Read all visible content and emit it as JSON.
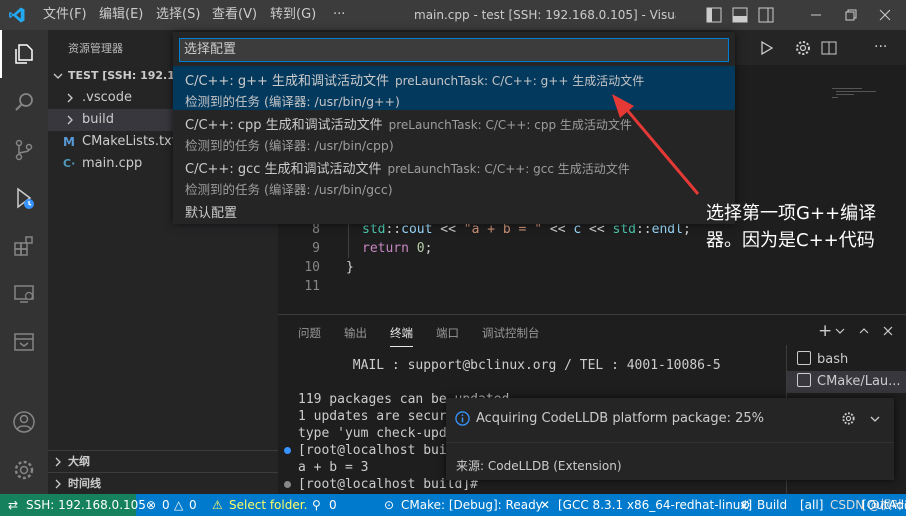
{
  "titlebar": {
    "menus": [
      "文件(F)",
      "编辑(E)",
      "选择(S)",
      "查看(V)",
      "转到(G)",
      "···"
    ],
    "title": "main.cpp - test [SSH: 192.168.0.105] - Visual Stu..."
  },
  "sidebar": {
    "header": "资源管理器",
    "root": "TEST [SSH: 192.168.0.",
    "items": [
      {
        "label": ".vscode",
        "kind": "folder"
      },
      {
        "label": "build",
        "kind": "folder"
      },
      {
        "label": "CMakeLists.txt",
        "kind": "cmake"
      },
      {
        "label": "main.cpp",
        "kind": "cpp"
      }
    ],
    "outline": "大纲",
    "timeline": "时间线"
  },
  "editor": {
    "lines": [
      {
        "n": "8",
        "code": "std::cout << \"a + b = \" << c << std::endl;"
      },
      {
        "n": "9",
        "code": "return 0;"
      },
      {
        "n": "10",
        "code": "}"
      },
      {
        "n": "11",
        "code": ""
      }
    ]
  },
  "quickpick": {
    "placeholder": "选择配置",
    "items": [
      {
        "title": "C/C++: g++ 生成和调试活动文件",
        "desc": "preLaunchTask: C/C++: g++ 生成活动文件",
        "detail": "检测到的任务 (编译器: /usr/bin/g++)",
        "highlighted": true
      },
      {
        "title": "C/C++: cpp 生成和调试活动文件",
        "desc": "preLaunchTask: C/C++: cpp 生成活动文件",
        "detail": "检测到的任务 (编译器: /usr/bin/cpp)",
        "highlighted": false
      },
      {
        "title": "C/C++: gcc 生成和调试活动文件",
        "desc": "preLaunchTask: C/C++: gcc 生成活动文件",
        "detail": "检测到的任务 (编译器: /usr/bin/gcc)",
        "highlighted": false
      }
    ],
    "default_config": "默认配置"
  },
  "annotation": {
    "line1": "选择第一项G++编译",
    "line2": "器。因为是C++代码"
  },
  "panel": {
    "tabs": [
      "问题",
      "输出",
      "终端",
      "端口",
      "调试控制台"
    ],
    "active_tab": "终端",
    "terminal": [
      "       MAIL : support@bclinux.org / TEL : 4001-10086-5",
      "",
      "119 packages can be updated.",
      "1 updates are securit",
      "type 'yum check-updat",
      "[root@localhost build",
      "a + b = 3",
      "[root@localhost build]#"
    ],
    "terminals": [
      "bash",
      "CMake/Lau..."
    ]
  },
  "notification": {
    "message": "Acquiring CodeLLDB platform package: 25%",
    "source": "来源: CodeLLDB (Extension)",
    "progress_percent": 25
  },
  "statusbar": {
    "remote": "SSH: 192.168.0.105",
    "errors": "0",
    "warnings": "0",
    "select_folder": "Select folder.",
    "ports": "0",
    "cmake": "CMake: [Debug]: Ready",
    "kit": "[GCC 8.3.1 x86_64-redhat-linux]",
    "build": "Build",
    "all": "[all]",
    "outadd": "[OutAdd",
    "watermark": "CSDN @枫叶2000"
  },
  "colors": {
    "accent": "#007acc",
    "remote": "#16825d",
    "highlight": "#04395e",
    "arrow": "#e53935"
  }
}
